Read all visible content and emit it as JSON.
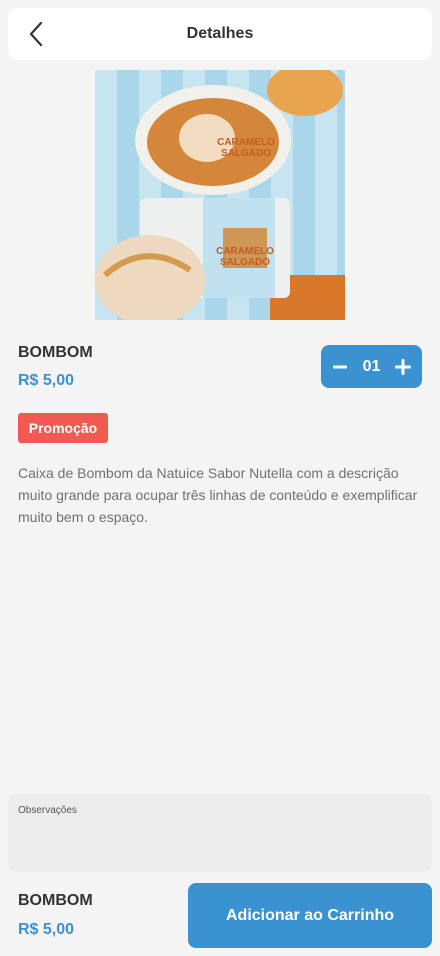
{
  "header": {
    "title": "Detalhes"
  },
  "product": {
    "image_label_line1": "CARAMELO",
    "image_label_line2": "SALGADO",
    "name": "BOMBOM",
    "price": "R$ 5,00",
    "badge": "Promoção",
    "description": "Caixa de Bombom da Natuice Sabor Nutella com a descrição muito grande para ocupar três linhas de conteúdo e exemplificar muito bem o espaço."
  },
  "quantity": {
    "value": "01"
  },
  "notes": {
    "label": "Observações"
  },
  "footer": {
    "name": "BOMBOM",
    "price": "R$ 5,00",
    "add_button_label": "Adicionar ao Carrinho"
  },
  "colors": {
    "accent": "#3a92d1",
    "promo": "#f05a52",
    "background": "#f4f4f4"
  }
}
